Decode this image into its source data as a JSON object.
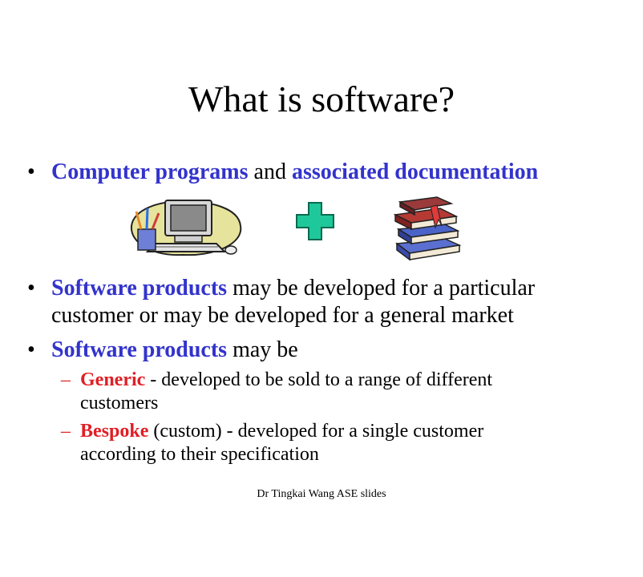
{
  "slide": {
    "title": "What is software?",
    "bullet_char": "•",
    "dash_char": "–",
    "bullets": [
      {
        "segments": [
          {
            "text": "Computer programs",
            "style": "blue"
          },
          {
            "text": " and ",
            "style": "plain"
          },
          {
            "text": "associated documentation",
            "style": "blue"
          }
        ]
      },
      {
        "line1_emph": "Software products",
        "line1_rest": " may be developed for a particular",
        "line2": "customer or may be developed for a general market"
      },
      {
        "line1_emph": "Software products",
        "line1_rest": " may be",
        "sub_items": [
          {
            "emph": "Generic",
            "rest": " - developed to be sold to a range of different",
            "line2": "customers"
          },
          {
            "emph": "Bespoke",
            "rest": " (custom) - developed for a single customer",
            "line2": "according to their specification"
          }
        ]
      }
    ],
    "images": [
      {
        "icon": "computer-clipart-icon"
      },
      {
        "icon": "plus-icon",
        "color": "#1fc89a"
      },
      {
        "icon": "books-clipart-icon"
      }
    ],
    "footer": "Dr Tingkai Wang ASE slides"
  },
  "colors": {
    "emphasis_blue": "#3333cc",
    "emphasis_red": "#e01f26",
    "plus_green": "#1fc89a"
  }
}
